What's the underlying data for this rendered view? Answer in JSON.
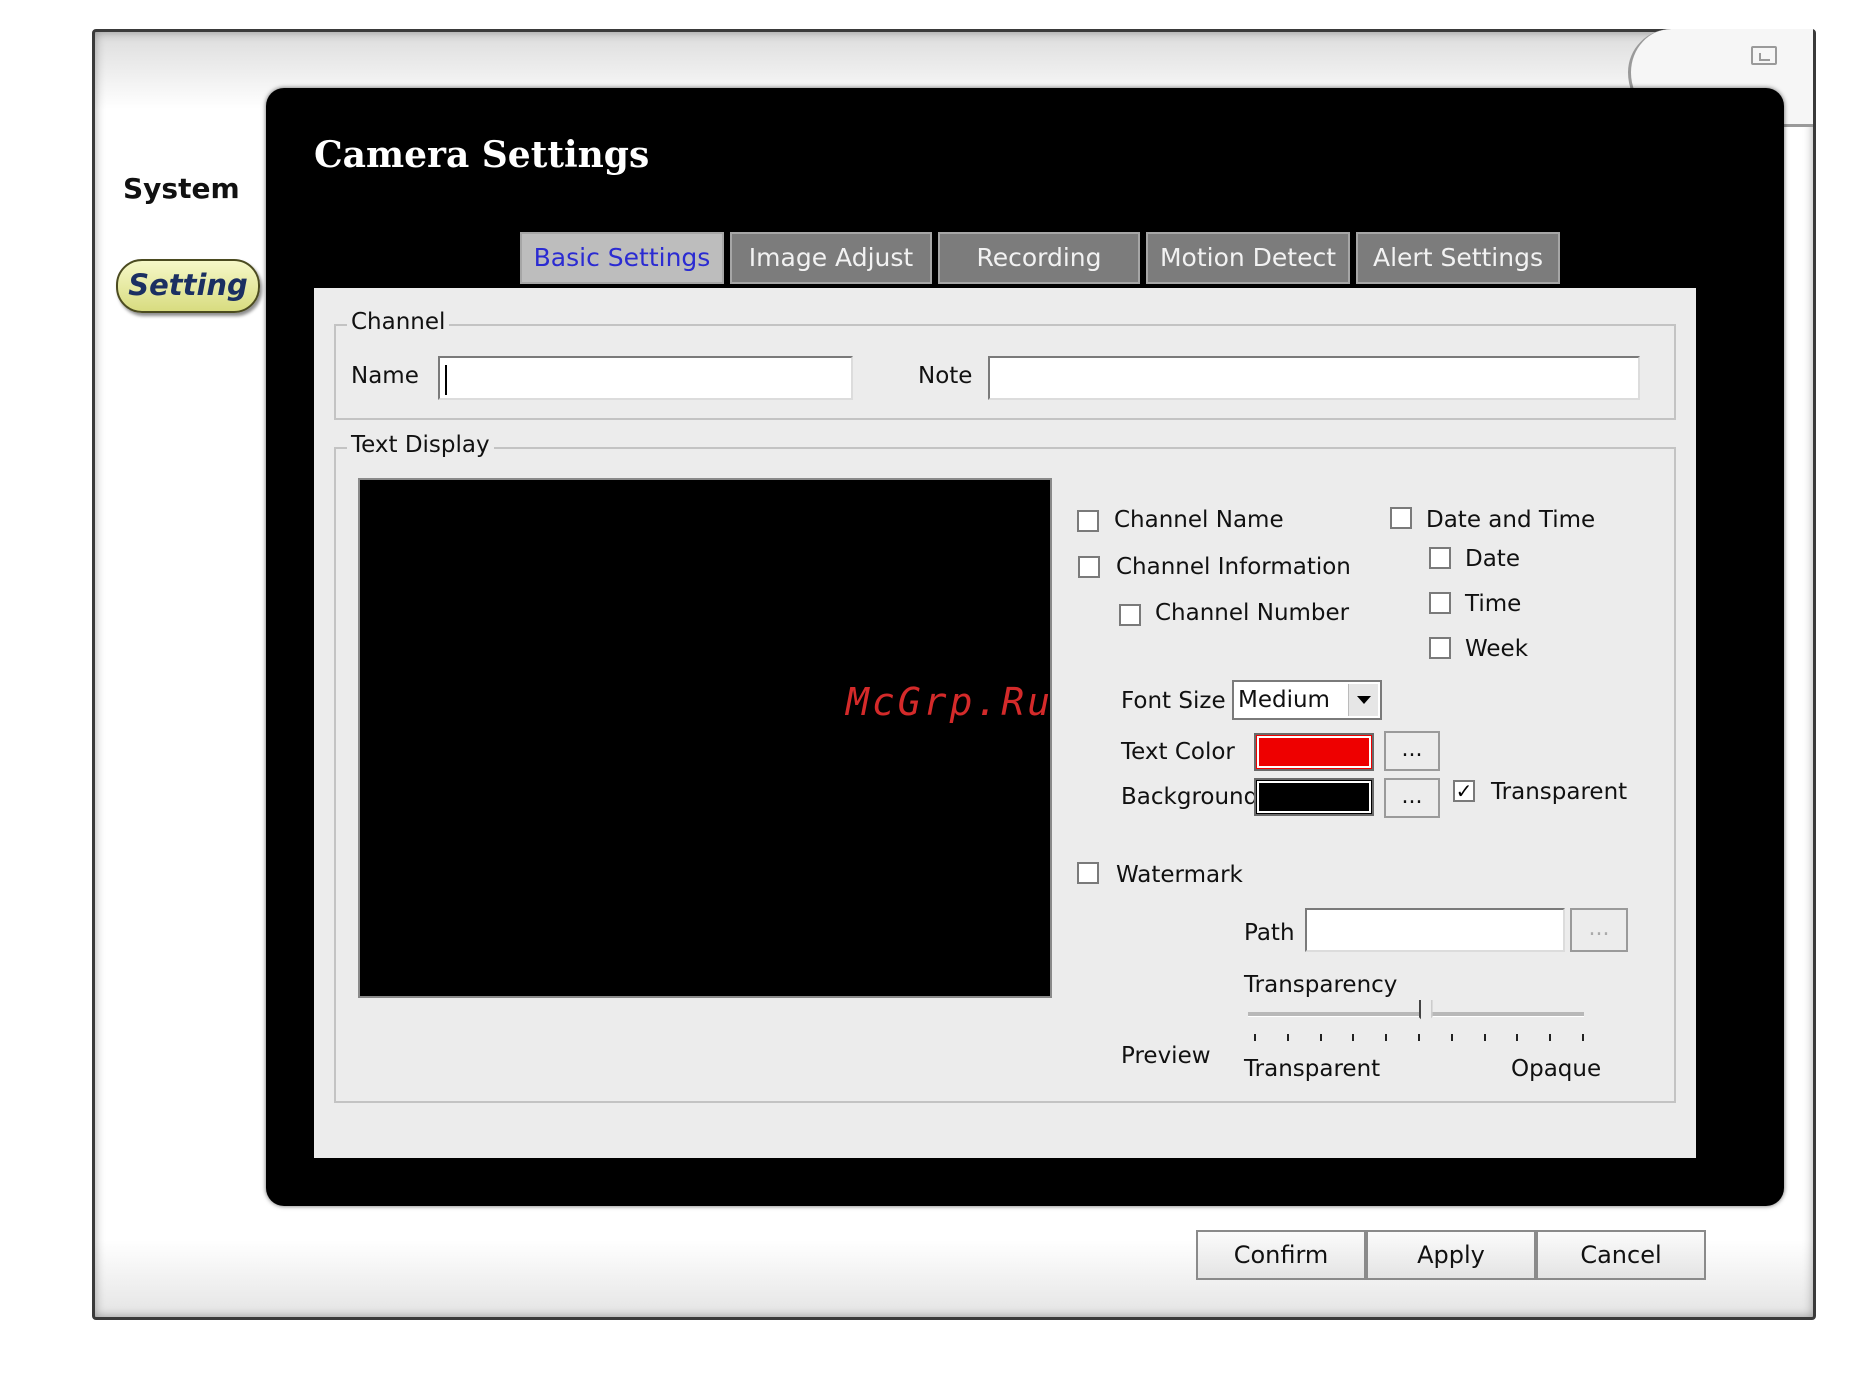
{
  "sidebar": {
    "title": "System",
    "button_label": "Setting"
  },
  "page_title": "Camera Settings",
  "tabs": [
    {
      "label": "Basic Settings",
      "active": true
    },
    {
      "label": "Image Adjust",
      "active": false
    },
    {
      "label": "Recording",
      "active": false
    },
    {
      "label": "Motion Detect",
      "active": false
    },
    {
      "label": "Alert Settings",
      "active": false
    }
  ],
  "channel": {
    "legend": "Channel",
    "name_label": "Name",
    "name_value": "",
    "note_label": "Note",
    "note_value": ""
  },
  "text_display": {
    "legend": "Text Display",
    "channel_name": {
      "label": "Channel Name",
      "checked": false
    },
    "channel_information": {
      "label": "Channel Information",
      "checked": false
    },
    "channel_number": {
      "label": "Channel Number",
      "checked": false
    },
    "date_and_time": {
      "label": "Date and Time",
      "checked": false
    },
    "date": {
      "label": "Date",
      "checked": false
    },
    "time": {
      "label": "Time",
      "checked": false
    },
    "week": {
      "label": "Week",
      "checked": false
    },
    "font_size_label": "Font Size",
    "font_size_value": "Medium",
    "text_color_label": "Text Color",
    "text_color": "#ee0000",
    "background_label": "Background",
    "background_color": "#000000",
    "picker_button_label": "...",
    "transparent": {
      "label": "Transparent",
      "checked": true
    },
    "watermark": {
      "label": "Watermark",
      "checked": false
    },
    "path_label": "Path",
    "path_value": "",
    "path_browse_label": "...",
    "transparency_label": "Transparency",
    "transparency_value": 0.52,
    "slider_min_label": "Transparent",
    "slider_max_label": "Opaque",
    "preview_label": "Preview"
  },
  "overlay_watermark": "McGrp.Ru",
  "buttons": {
    "confirm": "Confirm",
    "apply": "Apply",
    "cancel": "Cancel"
  }
}
